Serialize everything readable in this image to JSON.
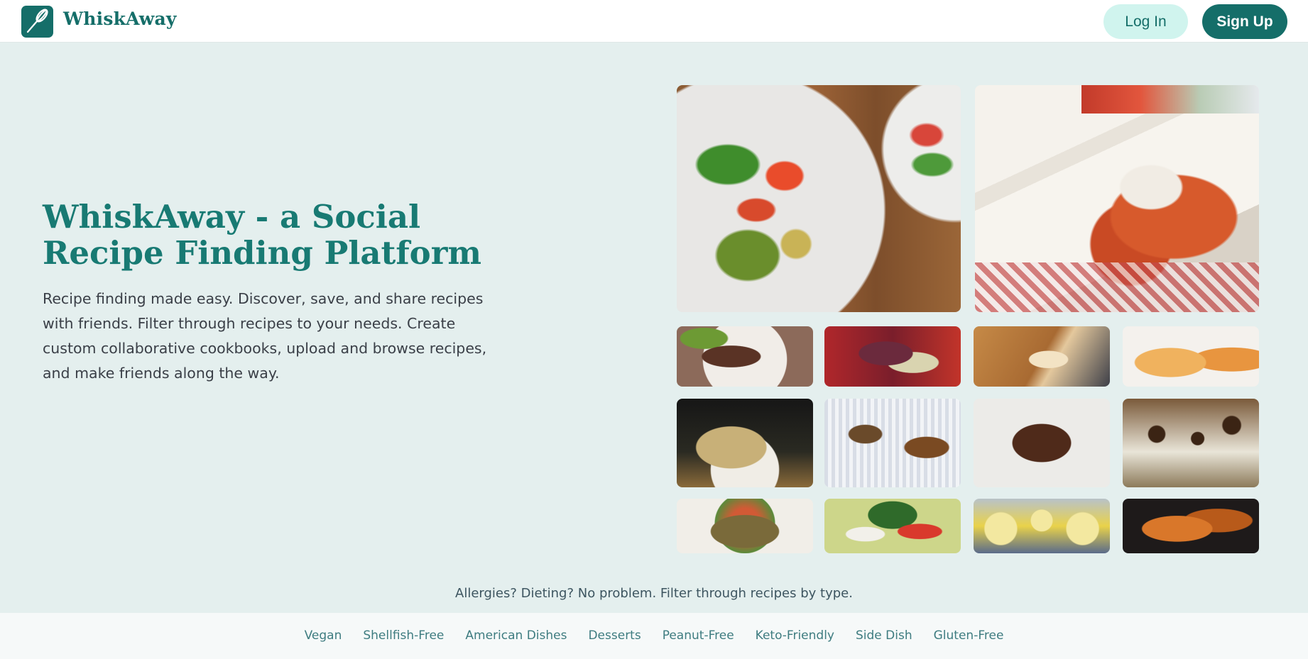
{
  "header": {
    "logo_icon": "whisk-icon",
    "brand": "WhiskAway",
    "login_label": "Log In",
    "signup_label": "Sign Up"
  },
  "hero": {
    "title": "WhiskAway - a Social Recipe Finding Platform",
    "description": "Recipe finding made easy. Discover, save, and share recipes with friends. Filter through recipes to your needs. Create custom collaborative cookbooks, upload and browse recipes, and make friends along the way."
  },
  "filters": {
    "tagline": "Allergies? Dieting? No problem. Filter through recipes by type.",
    "items": [
      "Vegan",
      "Shellfish-Free",
      "American Dishes",
      "Desserts",
      "Peanut-Free",
      "Keto-Friendly",
      "Side Dish",
      "Gluten-Free"
    ]
  },
  "colors": {
    "brand": "#156e69",
    "page_background": "#e4efee",
    "login_button_background": "#d0f4ee",
    "filter_link": "#3e7c80"
  }
}
